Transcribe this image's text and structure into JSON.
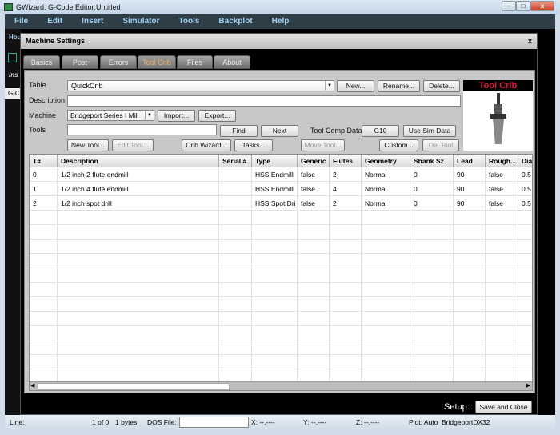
{
  "window": {
    "title": "GWizard: G-Code Editor:Untitled",
    "minimize": "–",
    "maximize": "□",
    "close": "x"
  },
  "menu": [
    "File",
    "Edit",
    "Insert",
    "Simulator",
    "Tools",
    "Backplot",
    "Help"
  ],
  "background": {
    "home": "Hou",
    "inspect": "Ins",
    "gcode": "G-C"
  },
  "dialog": {
    "title": "Machine Settings",
    "close": "x",
    "tabs": [
      "Basics",
      "Post",
      "Errors",
      "Tool Crib",
      "Files",
      "About"
    ],
    "active_tab": "Tool Crib",
    "table_label": "Table",
    "table_value": "QuickCrib",
    "new": "New...",
    "rename": "Rename...",
    "delete": "Delete...",
    "description_label": "Description",
    "description_value": "",
    "machine_label": "Machine",
    "machine_value": "Bridgeport Series I Mill",
    "import": "Import...",
    "export": "Export...",
    "tools_label": "Tools",
    "tools_value": "",
    "find": "Find",
    "next": "Next",
    "tool_comp_label": "Tool Comp Data",
    "g10": "G10",
    "use_sim": "Use Sim Data",
    "new_tool": "New Tool...",
    "edit_tool": "Edit Tool...",
    "crib_wizard": "Crib Wizard...",
    "tasks": "Tasks...",
    "move_tool": "Move Tool...",
    "custom": "Custom...",
    "del_tool": "Del Tool",
    "image_title": "Tool Crib",
    "columns": [
      "T#",
      "Description",
      "Serial #",
      "Type",
      "Generic",
      "Flutes",
      "Geometry",
      "Shank Sz",
      "Lead",
      "Rough...",
      "Diar"
    ],
    "rows": [
      [
        "0",
        "1/2 inch 2 flute endmill",
        "",
        "HSS Endmill",
        "false",
        "2",
        "Normal",
        "0",
        "90",
        "false",
        "0.5"
      ],
      [
        "1",
        "1/2 inch 4 flute endmill",
        "",
        "HSS Endmill",
        "false",
        "4",
        "Normal",
        "0",
        "90",
        "false",
        "0.5"
      ],
      [
        "2",
        "1/2 inch spot drill",
        "",
        "HSS Spot Dri",
        "false",
        "2",
        "Normal",
        "0",
        "90",
        "false",
        "0.5"
      ]
    ],
    "setup_label": "Setup:",
    "save_close": "Save and Close"
  },
  "status": {
    "line": "Line:",
    "pos": "1 of 0",
    "bytes": "1 bytes",
    "dos_label": "DOS File:",
    "dos_value": "",
    "x": "X:  --,----",
    "y": "Y:  --,----",
    "z": "Z:  --,----",
    "plot": "Plot: Auto",
    "machine": "BridgeportDX32"
  }
}
